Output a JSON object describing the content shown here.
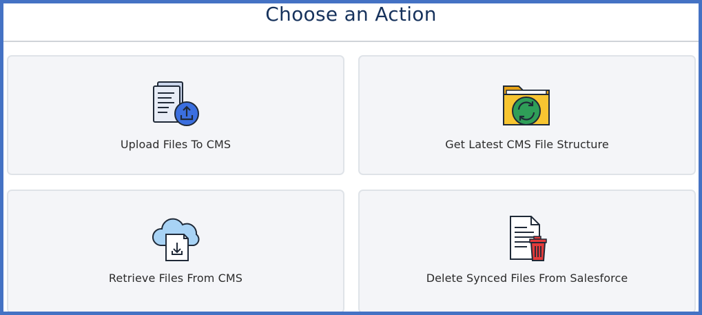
{
  "header": {
    "title": "Choose an Action"
  },
  "actions": [
    {
      "label": "Upload Files To CMS",
      "icon": "upload-document-icon"
    },
    {
      "label": "Get Latest CMS File Structure",
      "icon": "folder-sync-icon"
    },
    {
      "label": "Retrieve Files From CMS",
      "icon": "cloud-download-icon"
    },
    {
      "label": "Delete Synced Files From Salesforce",
      "icon": "document-delete-icon"
    }
  ],
  "colors": {
    "frame_border": "#4472c4",
    "title_text": "#16325c",
    "card_background": "#f4f5f8",
    "card_border": "#dfe3e8"
  }
}
